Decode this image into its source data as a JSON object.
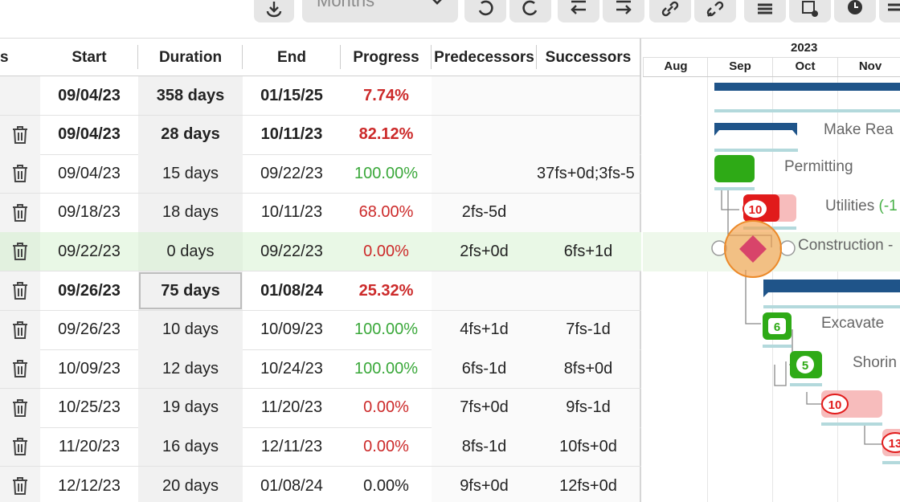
{
  "toolbar": {
    "zoom_select": {
      "value": "Months"
    },
    "buttons": [
      {
        "name": "export-button",
        "icon": "export-icon"
      },
      {
        "name": "undo-button",
        "icon": "undo-icon"
      },
      {
        "name": "redo-button",
        "icon": "redo-icon"
      },
      {
        "name": "outdent-button",
        "icon": "outdent-icon"
      },
      {
        "name": "indent-button",
        "icon": "indent-icon"
      },
      {
        "name": "link-button",
        "icon": "link-icon"
      },
      {
        "name": "unlink-button",
        "icon": "unlink-icon"
      },
      {
        "name": "critical-path-button",
        "icon": "list-icon"
      },
      {
        "name": "baseline-button",
        "icon": "calendar-gear-icon"
      },
      {
        "name": "clock-button",
        "icon": "clock-icon"
      }
    ]
  },
  "grid": {
    "columns": {
      "actions": "s",
      "start": "Start",
      "duration": "Duration",
      "end": "End",
      "progress": "Progress",
      "predecessors": "Predecessors",
      "successors": "Successors"
    },
    "rows": [
      {
        "start": "09/04/23",
        "duration": "358 days",
        "end": "01/15/25",
        "progress": "7.74%",
        "progress_color": "red",
        "predecessors": "",
        "successors": "",
        "summary": true,
        "has_delete": false
      },
      {
        "start": "09/04/23",
        "duration": "28 days",
        "end": "10/11/23",
        "progress": "82.12%",
        "progress_color": "red",
        "predecessors": "",
        "successors": "",
        "summary": true,
        "has_delete": true
      },
      {
        "start": "09/04/23",
        "duration": "15 days",
        "end": "09/22/23",
        "progress": "100.00%",
        "progress_color": "green",
        "predecessors": "",
        "successors": "37fs+0d;3fs-5",
        "summary": false,
        "has_delete": true
      },
      {
        "start": "09/18/23",
        "duration": "18 days",
        "end": "10/11/23",
        "progress": "68.00%",
        "progress_color": "red",
        "predecessors": "2fs-5d",
        "successors": "",
        "summary": false,
        "has_delete": true
      },
      {
        "start": "09/22/23",
        "duration": "0 days",
        "end": "09/22/23",
        "progress": "0.00%",
        "progress_color": "red",
        "predecessors": "2fs+0d",
        "successors": "6fs+1d",
        "summary": false,
        "has_delete": true,
        "highlighted": true
      },
      {
        "start": "09/26/23",
        "duration": "75 days",
        "end": "01/08/24",
        "progress": "25.32%",
        "progress_color": "red",
        "predecessors": "",
        "successors": "",
        "summary": true,
        "has_delete": true,
        "selected_cell": "duration"
      },
      {
        "start": "09/26/23",
        "duration": "10 days",
        "end": "10/09/23",
        "progress": "100.00%",
        "progress_color": "green",
        "predecessors": "4fs+1d",
        "successors": "7fs-1d",
        "summary": false,
        "has_delete": true
      },
      {
        "start": "10/09/23",
        "duration": "12 days",
        "end": "10/24/23",
        "progress": "100.00%",
        "progress_color": "green",
        "predecessors": "6fs-1d",
        "successors": "8fs+0d",
        "summary": false,
        "has_delete": true
      },
      {
        "start": "10/25/23",
        "duration": "19 days",
        "end": "11/20/23",
        "progress": "0.00%",
        "progress_color": "red",
        "predecessors": "7fs+0d",
        "successors": "9fs-1d",
        "summary": false,
        "has_delete": true
      },
      {
        "start": "11/20/23",
        "duration": "16 days",
        "end": "12/11/23",
        "progress": "0.00%",
        "progress_color": "red",
        "predecessors": "8fs-1d",
        "successors": "10fs+0d",
        "summary": false,
        "has_delete": true
      },
      {
        "start": "12/12/23",
        "duration": "20 days",
        "end": "01/08/24",
        "progress": "0.00%",
        "progress_color": "plain",
        "predecessors": "9fs+0d",
        "successors": "12fs+0d",
        "summary": false,
        "has_delete": true
      }
    ]
  },
  "gantt": {
    "year": "2023",
    "months": [
      "Aug",
      "Sep",
      "Oct",
      "Nov"
    ],
    "task_labels": {
      "make_ready": "Make Rea",
      "permitting": "Permitting",
      "utilities": "Utilities",
      "utilities_delay": "(-1",
      "construction": "Construction -",
      "excavate": "Excavate",
      "shoring": "Shorin"
    },
    "badges": {
      "utilities": "10",
      "excavate": "6",
      "shoring": "5",
      "task8": "10",
      "task9": "13"
    },
    "colors": {
      "summary_bar": "#1f5489",
      "complete": "#2eaa16",
      "late": "#e11b1b",
      "late_bg": "#f7bcbc",
      "milestone": "#d8446a",
      "milestone_halo": "#f4a14d",
      "baseline": "#b3d9dc"
    }
  }
}
